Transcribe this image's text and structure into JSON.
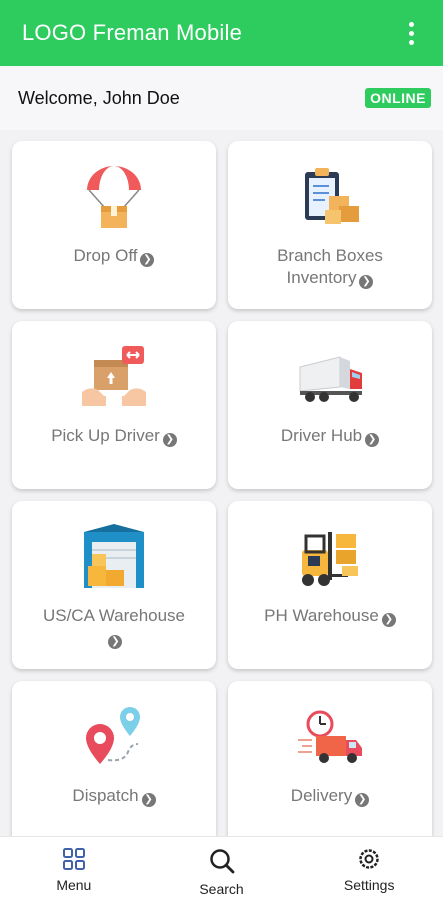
{
  "appbar": {
    "title": "LOGO Freman Mobile"
  },
  "welcome": {
    "message": "Welcome, John Doe",
    "status": "ONLINE"
  },
  "cards": [
    {
      "label": "Drop Off",
      "icon": "parachute-box-icon"
    },
    {
      "label": "Branch Boxes Inventory",
      "icon": "clipboard-boxes-icon"
    },
    {
      "label": "Pick Up Driver",
      "icon": "hands-box-icon"
    },
    {
      "label": "Driver Hub",
      "icon": "truck-icon"
    },
    {
      "label": "US/CA Warehouse",
      "icon": "warehouse-icon"
    },
    {
      "label": "PH Warehouse",
      "icon": "forklift-icon"
    },
    {
      "label": "Dispatch",
      "icon": "route-pins-icon"
    },
    {
      "label": "Delivery",
      "icon": "fast-delivery-icon"
    }
  ],
  "nav": [
    {
      "label": "Menu",
      "icon": "grid-icon"
    },
    {
      "label": "Search",
      "icon": "search-icon"
    },
    {
      "label": "Settings",
      "icon": "gear-icon"
    }
  ],
  "colors": {
    "accent": "#2ecc5f"
  }
}
